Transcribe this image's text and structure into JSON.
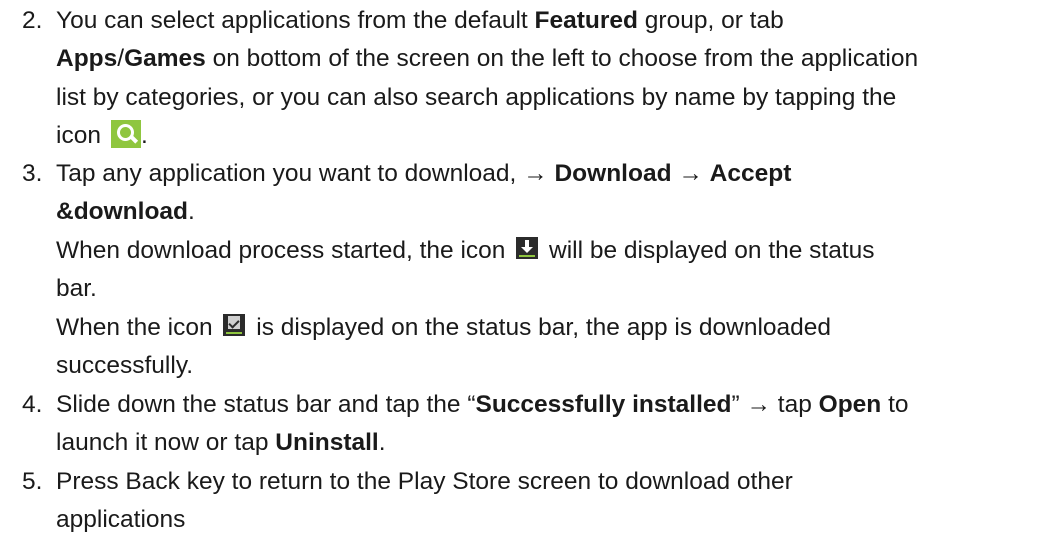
{
  "steps": [
    {
      "number": "2.",
      "lines": [
        {
          "t1": "You can select applications from the default ",
          "b1": "Featured",
          "t2": " group, or tab"
        },
        {
          "b1": "Apps",
          "t1": "/",
          "b2": "Games",
          "t2": " on bottom of the screen on the left to choose from the application"
        },
        {
          "t1": "list by categories, or you can also search applications by name by tapping the"
        },
        {
          "t1": "icon",
          "t2": "."
        }
      ],
      "icon": "search-icon"
    },
    {
      "number": "3.",
      "lines": [
        {
          "t1": "Tap any application you want to download, → ",
          "b1": "Download",
          "t2": " → ",
          "b2": "Accept"
        },
        {
          "b1": "&download",
          "t1": "."
        },
        {
          "t1": "When download process started, the icon",
          "t2": "will be displayed on the status"
        },
        {
          "t1": "bar."
        },
        {
          "t1": "When the icon",
          "t2": "is displayed on the status bar, the app is downloaded"
        },
        {
          "t1": "successfully."
        }
      ],
      "icons": [
        "download-icon",
        "download-complete-icon"
      ]
    },
    {
      "number": "4.",
      "lines": [
        {
          "t1": "Slide down the status bar and tap the “",
          "b1": "Successfully installed",
          "t2": "” → tap ",
          "b2": "Open",
          "t3": " to"
        },
        {
          "t1": "launch it now or tap ",
          "b1": "Uninstall",
          "t2": "."
        }
      ]
    },
    {
      "number": "5.",
      "lines": [
        {
          "t1": "Press Back key to return to the Play Store screen to download other"
        },
        {
          "t1": "applications"
        }
      ]
    }
  ],
  "colors": {
    "text": "#1a1a1a",
    "search_icon_bg": "#8fc63f",
    "status_icon_bg": "#2b2b2b"
  }
}
